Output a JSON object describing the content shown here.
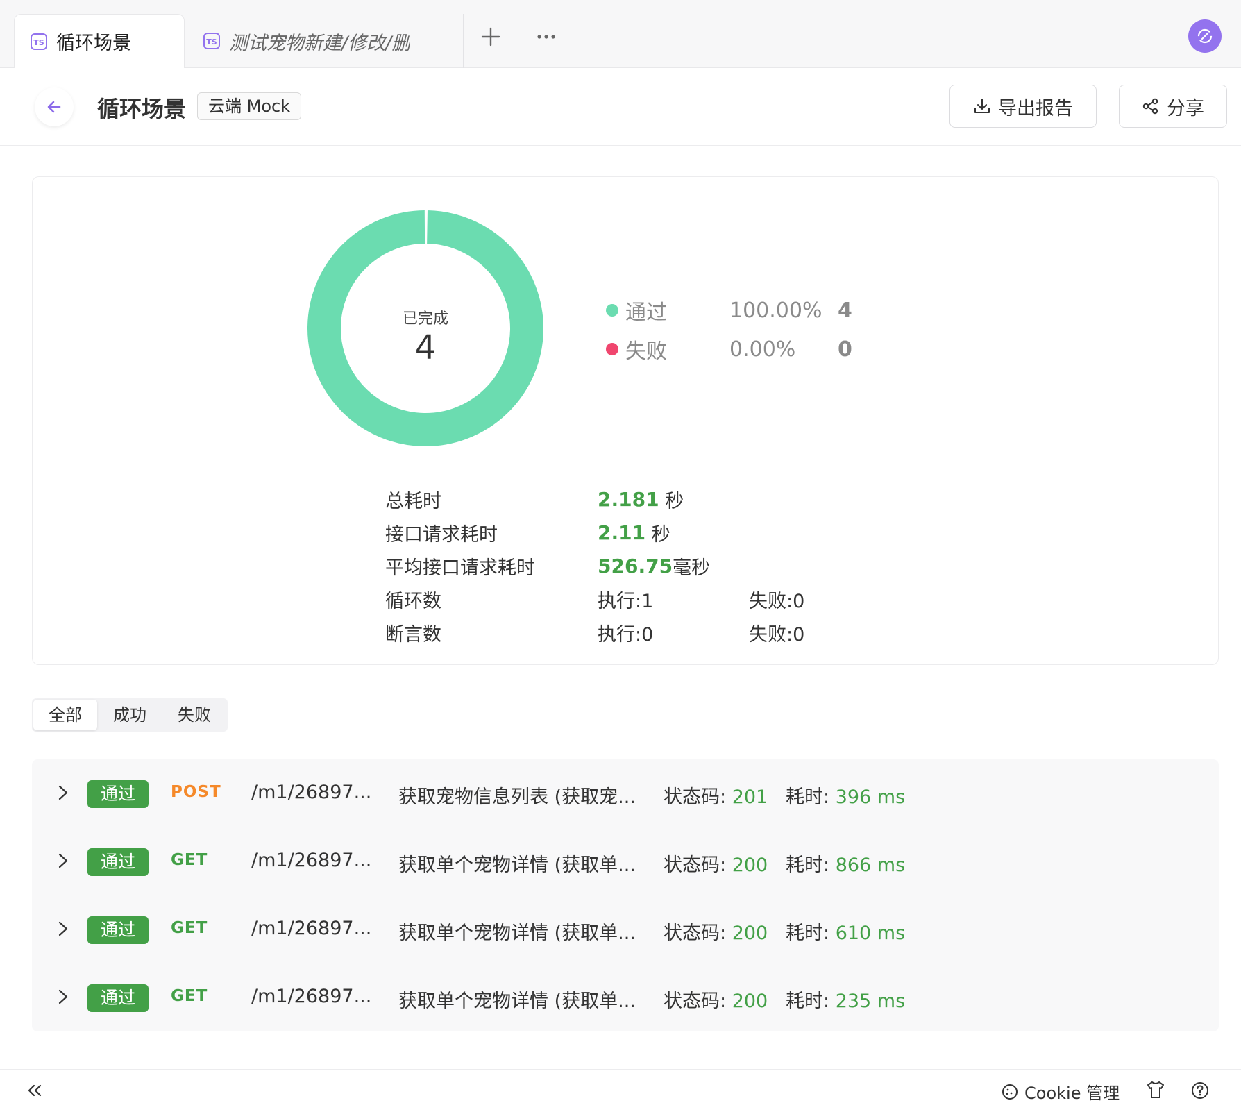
{
  "tabs": [
    {
      "label": "循环场景",
      "icon": "ts-file-icon",
      "active": true
    },
    {
      "label": "测试宠物新建/修改/删",
      "icon": "ts-file-icon",
      "active": false
    }
  ],
  "header": {
    "title": "循环场景",
    "env_tag": "云端 Mock",
    "export_label": "导出报告",
    "share_label": "分享"
  },
  "summary": {
    "donut_label": "已完成",
    "donut_value": "4",
    "pass_fraction": 1.0,
    "colors": {
      "pass": "#6bdcb0",
      "fail": "#f0466e"
    },
    "legend": [
      {
        "name": "通过",
        "pct": "100.00%",
        "count": "4"
      },
      {
        "name": "失败",
        "pct": "0.00%",
        "count": "0"
      }
    ],
    "stats": [
      {
        "label": "总耗时",
        "num": "2.181",
        "unit": " 秒"
      },
      {
        "label": "接口请求耗时",
        "num": "2.11",
        "unit": " 秒"
      },
      {
        "label": "平均接口请求耗时",
        "num": "526.75",
        "unit": "毫秒"
      }
    ],
    "loops": {
      "label": "循环数",
      "exec": "执行:1",
      "fail": "失败:0"
    },
    "asserts": {
      "label": "断言数",
      "exec": "执行:0",
      "fail": "失败:0"
    }
  },
  "filter": {
    "options": [
      "全部",
      "成功",
      "失败"
    ],
    "selected": 0
  },
  "results": [
    {
      "badge": "通过",
      "method": "POST",
      "method_color": "#f5892a",
      "path": "/m1/26897...",
      "name": "获取宠物信息列表 (获取宠...",
      "status_label": "状态码: ",
      "status": "201",
      "time_label": "耗时: ",
      "time": "396 ms"
    },
    {
      "badge": "通过",
      "method": "GET",
      "method_color": "#43a047",
      "path": "/m1/26897...",
      "name": "获取单个宠物详情 (获取单...",
      "status_label": "状态码: ",
      "status": "200",
      "time_label": "耗时: ",
      "time": "866 ms"
    },
    {
      "badge": "通过",
      "method": "GET",
      "method_color": "#43a047",
      "path": "/m1/26897...",
      "name": "获取单个宠物详情 (获取单...",
      "status_label": "状态码: ",
      "status": "200",
      "time_label": "耗时: ",
      "time": "610 ms"
    },
    {
      "badge": "通过",
      "method": "GET",
      "method_color": "#43a047",
      "path": "/m1/26897...",
      "name": "获取单个宠物详情 (获取单...",
      "status_label": "状态码: ",
      "status": "200",
      "time_label": "耗时: ",
      "time": "235 ms"
    }
  ],
  "footer": {
    "cookie_label": "Cookie 管理"
  }
}
